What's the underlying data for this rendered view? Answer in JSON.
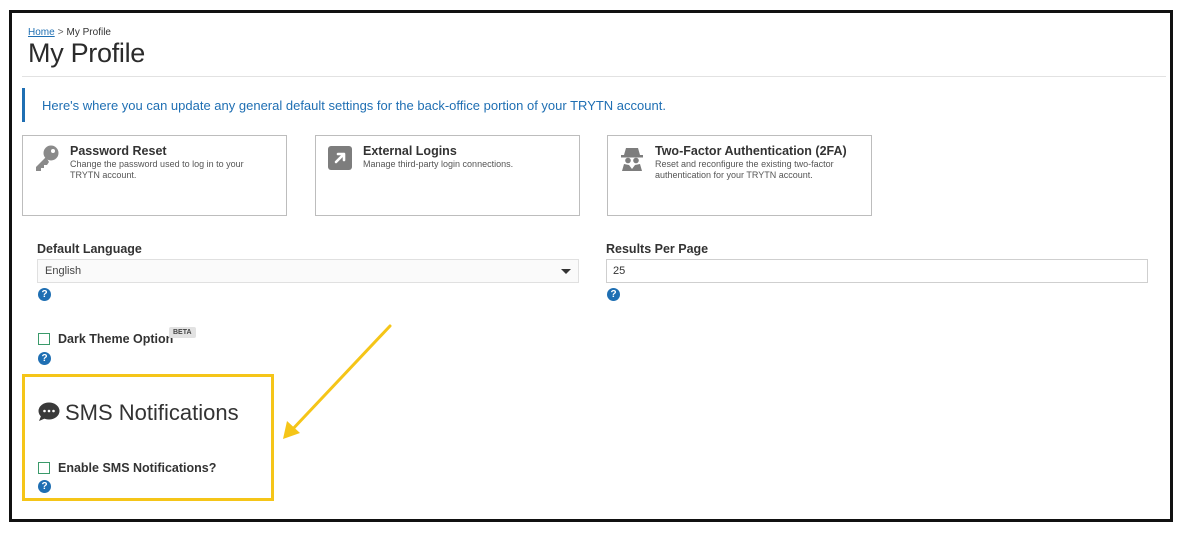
{
  "breadcrumb": {
    "home": "Home",
    "separator": ">",
    "current": "My Profile"
  },
  "page_title": "My Profile",
  "info_text": "Here's where you can update any general default settings for the back-office portion of your TRYTN account.",
  "cards": [
    {
      "title": "Password Reset",
      "description": "Change the password used to log in to your TRYTN account.",
      "icon": "key-icon"
    },
    {
      "title": "External Logins",
      "description": "Manage third-party login connections.",
      "icon": "external-link-icon"
    },
    {
      "title": "Two-Factor Authentication (2FA)",
      "description": "Reset and reconfigure the existing two-factor authentication for your TRYTN account.",
      "icon": "spy-icon"
    }
  ],
  "default_language": {
    "label": "Default Language",
    "value": "English"
  },
  "results_per_page": {
    "label": "Results Per Page",
    "value": "25"
  },
  "dark_theme": {
    "label": "Dark Theme Option",
    "badge": "BETA",
    "checked": false
  },
  "sms": {
    "title": "SMS Notifications",
    "enable_label": "Enable SMS Notifications?",
    "checked": false
  },
  "help_glyph": "?",
  "colors": {
    "accent": "#1f6fb3",
    "highlight": "#f5c518",
    "checkbox": "#3a9a6a"
  }
}
